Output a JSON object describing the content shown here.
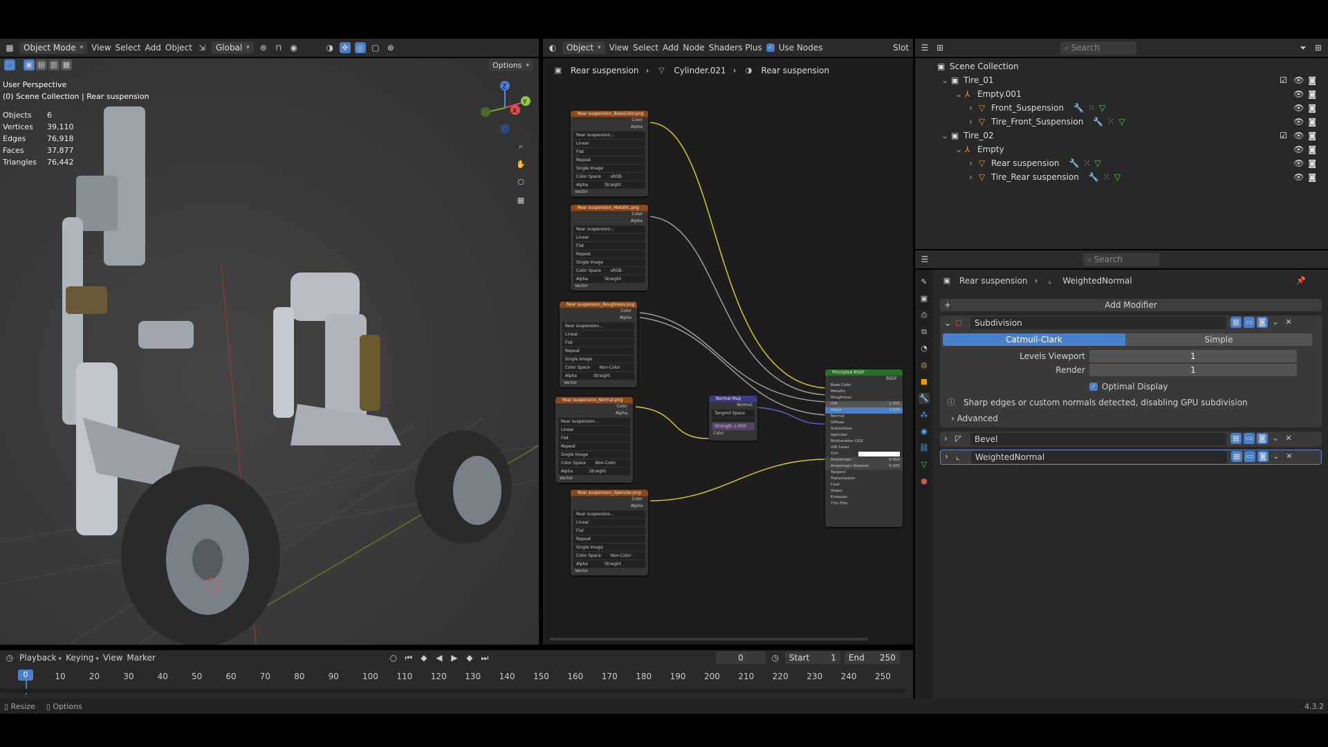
{
  "viewport_header": {
    "mode": "Object Mode",
    "view": "View",
    "select": "Select",
    "add": "Add",
    "object": "Object",
    "transform": "Global",
    "options": "Options"
  },
  "viewport_info": {
    "perspective": "User Perspective",
    "collection": "(0) Scene Collection | Rear suspension",
    "stats": [
      {
        "k": "Objects",
        "v": "6"
      },
      {
        "k": "Vertices",
        "v": "39,110"
      },
      {
        "k": "Edges",
        "v": "76,918"
      },
      {
        "k": "Faces",
        "v": "37,877"
      },
      {
        "k": "Triangles",
        "v": "76,442"
      }
    ]
  },
  "node_header": {
    "type": "Object",
    "view": "View",
    "select": "Select",
    "add": "Add",
    "node": "Node",
    "shaders_plus": "Shaders Plus",
    "use_nodes": "Use Nodes",
    "slot": "Slot"
  },
  "node_breadcrumb": [
    "Rear suspension",
    "Cylinder.021",
    "Rear suspension"
  ],
  "nodes": [
    {
      "title": "Rear suspension_BaseColor.png",
      "cs": "sRGB",
      "alpha": "Straight"
    },
    {
      "title": "Rear suspension_Metallic.png",
      "cs": "sRGB",
      "alpha": "Straight"
    },
    {
      "title": "Rear suspension_Roughness.png",
      "cs": "Non-Color",
      "alpha": "Straight"
    },
    {
      "title": "Rear suspension_Normal.png",
      "cs": "Non-Color",
      "alpha": "Straight"
    },
    {
      "title": "Rear suspension_Specular.png",
      "cs": "Non-Color",
      "alpha": "Straight"
    }
  ],
  "node_rows": {
    "color": "Color",
    "alpha": "Alpha",
    "img": "Rear suspension...",
    "linear": "Linear",
    "flat": "Flat",
    "repeat": "Repeat",
    "single": "Single Image",
    "colorspace": "Color Space",
    "alpha_l": "Alpha",
    "vector": "Vector"
  },
  "normal_map": {
    "title": "Normal Map",
    "normal": "Normal",
    "space": "Tangent Space",
    "strength": "Strength",
    "strength_v": "1.000",
    "color": "Color"
  },
  "bsdf": {
    "title": "Principled BSDF",
    "out": "BSDF",
    "rows": [
      "Base Color",
      "Metallic",
      "Roughness",
      "IOR",
      "Alpha",
      "Normal",
      "Diffuse",
      "Subsurface",
      "Specular",
      "Multiscatter GGX",
      "IOR Level",
      "Tint",
      "Anisotropic",
      "Anisotropic Rotation",
      "Tangent",
      "Transmission",
      "Coat",
      "Sheen",
      "Emission",
      "Thin Film"
    ],
    "ior_v": "1.500",
    "alpha_v": "1.000",
    "aniso_v": "0.000",
    "rot_v": "0.000"
  },
  "outliner": {
    "search": "Search",
    "items": [
      {
        "label": "Scene Collection",
        "indent": 0,
        "icon": "collection"
      },
      {
        "label": "Tire_01",
        "indent": 1,
        "icon": "collection"
      },
      {
        "label": "Empty.001",
        "indent": 2,
        "icon": "empty"
      },
      {
        "label": "Front_Suspension",
        "indent": 3,
        "icon": "mesh"
      },
      {
        "label": "Tire_Front_Suspension",
        "indent": 3,
        "icon": "mesh"
      },
      {
        "label": "Tire_02",
        "indent": 1,
        "icon": "collection"
      },
      {
        "label": "Empty",
        "indent": 2,
        "icon": "empty"
      },
      {
        "label": "Rear suspension",
        "indent": 3,
        "icon": "mesh"
      },
      {
        "label": "Tire_Rear suspension",
        "indent": 3,
        "icon": "mesh"
      }
    ]
  },
  "properties": {
    "search": "Search",
    "breadcrumb_obj": "Rear suspension",
    "breadcrumb_mod": "WeightedNormal",
    "add_modifier": "Add Modifier",
    "subdivision": {
      "name": "Subdivision",
      "catmull": "Catmull-Clark",
      "simple": "Simple",
      "levels_label": "Levels Viewport",
      "levels": "1",
      "render_label": "Render",
      "render": "1",
      "optimal": "Optimal Display",
      "warning": "Sharp edges or custom normals detected, disabling GPU subdivision",
      "advanced": "Advanced"
    },
    "bevel": "Bevel",
    "weighted": "WeightedNormal"
  },
  "timeline": {
    "playback": "Playback",
    "keying": "Keying",
    "view": "View",
    "marker": "Marker",
    "frame": "0",
    "start_label": "Start",
    "start": "1",
    "end_label": "End",
    "end": "250",
    "ticks": [
      "0",
      "10",
      "20",
      "30",
      "40",
      "50",
      "60",
      "70",
      "80",
      "90",
      "100",
      "110",
      "120",
      "130",
      "140",
      "150",
      "160",
      "170",
      "180",
      "190",
      "200",
      "210",
      "220",
      "230",
      "240",
      "250"
    ]
  },
  "status": {
    "resize": "Resize",
    "options": "Options",
    "version": "4.3.2"
  },
  "colors": {
    "accent": "#4a7fc9",
    "image_node": "#8a4a1d",
    "vector_node": "#3c3c83",
    "shader_node": "#2b6e2b",
    "link_yellow": "#cccc33",
    "link_grey": "#a0a0a0",
    "link_purple": "#6363c7"
  }
}
